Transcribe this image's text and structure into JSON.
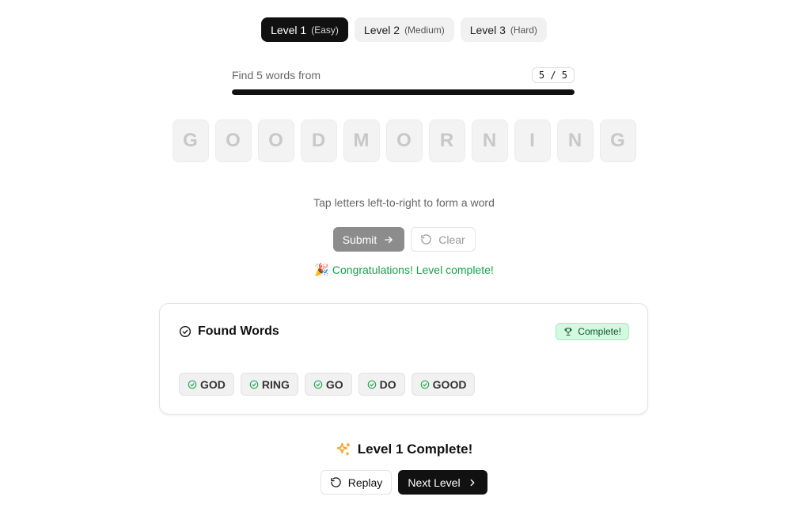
{
  "levels": [
    {
      "label": "Level 1",
      "difficulty": "(Easy)",
      "active": true
    },
    {
      "label": "Level 2",
      "difficulty": "(Medium)",
      "active": false
    },
    {
      "label": "Level 3",
      "difficulty": "(Hard)",
      "active": false
    }
  ],
  "progress": {
    "label": "Find 5 words from",
    "count": "5 / 5",
    "fraction": 1.0
  },
  "letters": [
    "G",
    "O",
    "O",
    "D",
    "M",
    "O",
    "R",
    "N",
    "I",
    "N",
    "G"
  ],
  "hint": "Tap letters left-to-right to form a word",
  "actions": {
    "submit_label": "Submit",
    "clear_label": "Clear"
  },
  "congrats": {
    "emoji": "🎉",
    "text": "Congratulations! Level complete!"
  },
  "found_words": {
    "title": "Found Words",
    "badge": "Complete!",
    "words": [
      "GOD",
      "RING",
      "GO",
      "DO",
      "GOOD"
    ]
  },
  "completion": {
    "title": "Level 1 Complete!",
    "replay_label": "Replay",
    "next_label": "Next Level"
  },
  "colors": {
    "success_text": "#16a34a",
    "badge_bg": "#d1fadf",
    "primary": "#111111",
    "sparkle": "#f5a524"
  },
  "icons": {
    "submit": "arrow-right-icon",
    "clear": "rotate-ccw-icon",
    "found_words": "check-circle-icon",
    "badge": "trophy-icon",
    "word": "check-circle-icon",
    "completion": "sparkles-icon",
    "replay": "rotate-ccw-icon",
    "next": "chevron-right-icon"
  }
}
